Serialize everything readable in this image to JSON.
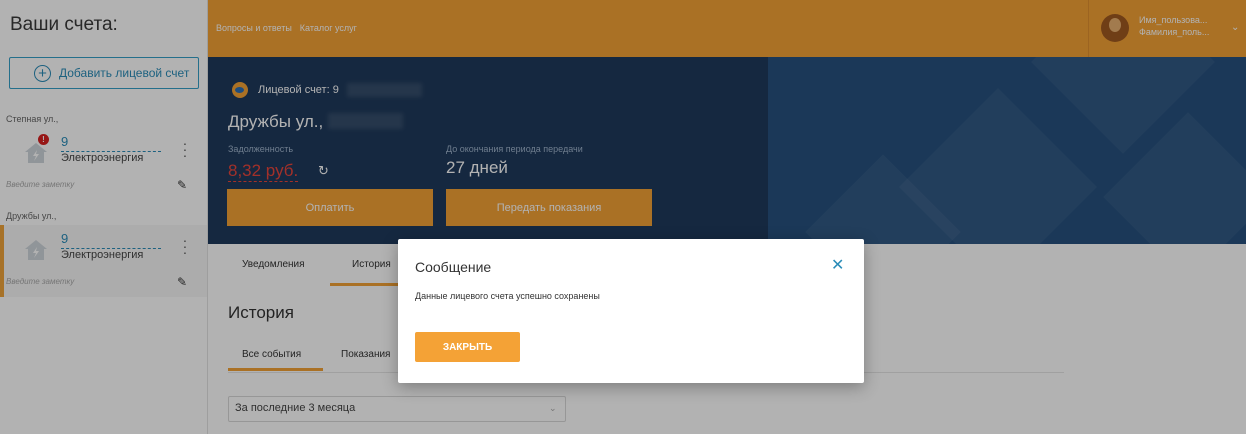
{
  "sidebar": {
    "title": "Ваши счета:",
    "add_button": "Добавить лицевой счет",
    "groups": [
      {
        "label": "Степная ул.,",
        "account_number": "9",
        "service": "Электроэнергия",
        "note_placeholder": "Введите заметку",
        "alert": "!"
      },
      {
        "label": "Дружбы ул.,",
        "account_number": "9",
        "service": "Электроэнергия",
        "note_placeholder": "Введите заметку"
      }
    ]
  },
  "topbar": {
    "links": [
      "Вопросы и ответы",
      "Каталог услуг"
    ],
    "user_first": "Имя_пользова...",
    "user_last": "Фамилия_поль..."
  },
  "hero": {
    "account_label": "Лицевой счет: 9",
    "street": "Дружбы ул.,",
    "debt_label": "Задолженность",
    "debt_value": "8,32 руб.",
    "period_label": "До окончания периода передачи",
    "period_value": "27 дней",
    "pay_button": "Оплатить",
    "submit_button": "Передать показания"
  },
  "tabs": [
    "Уведомления",
    "История"
  ],
  "history": {
    "title": "История",
    "sub_tabs": [
      "Все события",
      "Показания"
    ],
    "period": "За последние 3 месяца"
  },
  "modal": {
    "title": "Сообщение",
    "text": "Данные лицевого счета успешно сохранены",
    "button": "ЗАКРЫТЬ"
  },
  "colors": {
    "accent": "#f4a236",
    "hero_bg": "#1f3a5c",
    "link": "#2a8cb8",
    "debt": "#e8453c"
  }
}
